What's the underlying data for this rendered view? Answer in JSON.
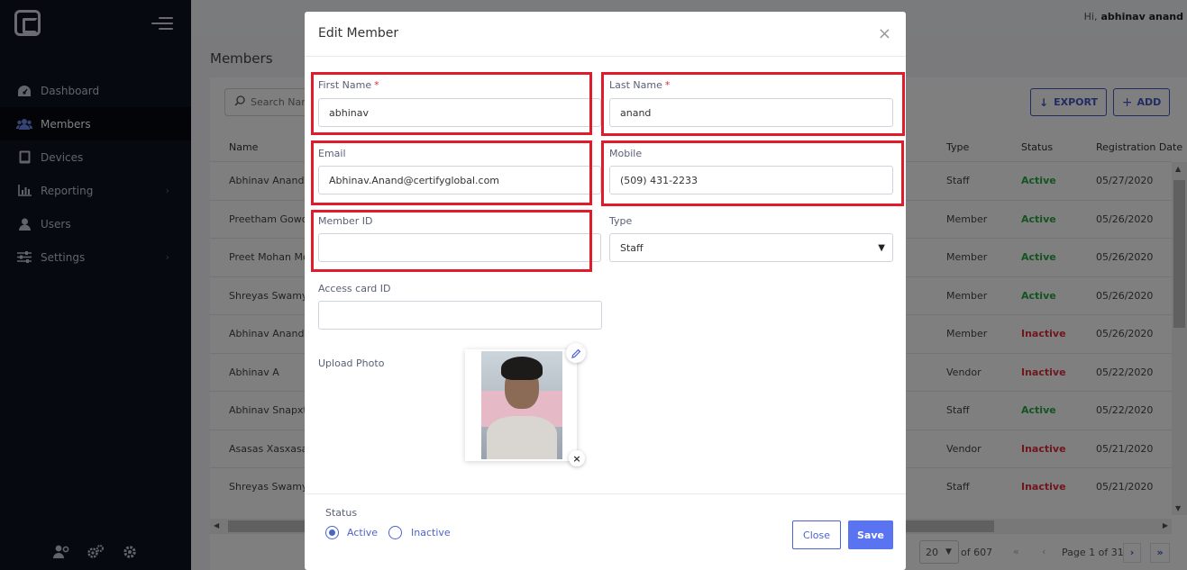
{
  "header": {
    "greeting": "Hi,",
    "user_name": "abhinav anand"
  },
  "sidebar": {
    "items": [
      {
        "label": "Dashboard",
        "icon": "dashboard-icon"
      },
      {
        "label": "Members",
        "icon": "users-group-icon",
        "active": true
      },
      {
        "label": "Devices",
        "icon": "tablet-icon"
      },
      {
        "label": "Reporting",
        "icon": "bar-chart-icon",
        "has_submenu": true
      },
      {
        "label": "Users",
        "icon": "user-icon"
      },
      {
        "label": "Settings",
        "icon": "sliders-icon",
        "has_submenu": true
      }
    ],
    "bottom_icons": [
      "user-settings-icon",
      "gears-icon",
      "gear-icon"
    ]
  },
  "page": {
    "title": "Members",
    "search_placeholder": "Search Nam",
    "export_label": "EXPORT",
    "add_label": "ADD",
    "columns": {
      "name": "Name",
      "type": "Type",
      "status": "Status",
      "registration_date": "Registration Date"
    },
    "rows": [
      {
        "name": "Abhinav Anand",
        "type": "Staff",
        "status": "Active",
        "date": "05/27/2020"
      },
      {
        "name": "Preetham Gowd",
        "type": "Member",
        "status": "Active",
        "date": "05/26/2020"
      },
      {
        "name": "Preet Mohan Mo",
        "type": "Member",
        "status": "Active",
        "date": "05/26/2020"
      },
      {
        "name": "Shreyas Swamy",
        "type": "Member",
        "status": "Active",
        "date": "05/26/2020"
      },
      {
        "name": "Abhinav Anand",
        "type": "Member",
        "status": "Inactive",
        "date": "05/26/2020"
      },
      {
        "name": "Abhinav A",
        "type": "Vendor",
        "status": "Inactive",
        "date": "05/22/2020"
      },
      {
        "name": "Abhinav Snapxt",
        "type": "Staff",
        "status": "Active",
        "date": "05/22/2020"
      },
      {
        "name": "Asasas Xasxasa",
        "type": "Vendor",
        "status": "Inactive",
        "date": "05/21/2020"
      },
      {
        "name": "Shreyas Swamy",
        "type": "Staff",
        "status": "Inactive",
        "date": "05/21/2020"
      }
    ],
    "pager": {
      "page_size": "20",
      "total_text": "of 607",
      "page_text": "Page 1 of 31"
    }
  },
  "modal": {
    "title": "Edit Member",
    "required_marker": "*",
    "first_name": {
      "label": "First Name",
      "value": "abhinav"
    },
    "last_name": {
      "label": "Last Name",
      "value": "anand"
    },
    "email": {
      "label": "Email",
      "value": "Abhinav.Anand@certifyglobal.com"
    },
    "mobile": {
      "label": "Mobile",
      "value": "(509) 431-2233"
    },
    "member_id": {
      "label": "Member ID",
      "value": ""
    },
    "type": {
      "label": "Type",
      "value": "Staff"
    },
    "access_card": {
      "label": "Access card ID",
      "value": ""
    },
    "upload_photo_label": "Upload Photo",
    "status": {
      "label": "Status",
      "active_label": "Active",
      "inactive_label": "Inactive",
      "selected": "Active"
    },
    "close_label": "Close",
    "save_label": "Save"
  },
  "colors": {
    "accent": "#4a63d2",
    "highlight": "#e01c2a",
    "active": "#27a844",
    "inactive": "#e02c3b",
    "sidebar_bg": "#0d1320"
  }
}
